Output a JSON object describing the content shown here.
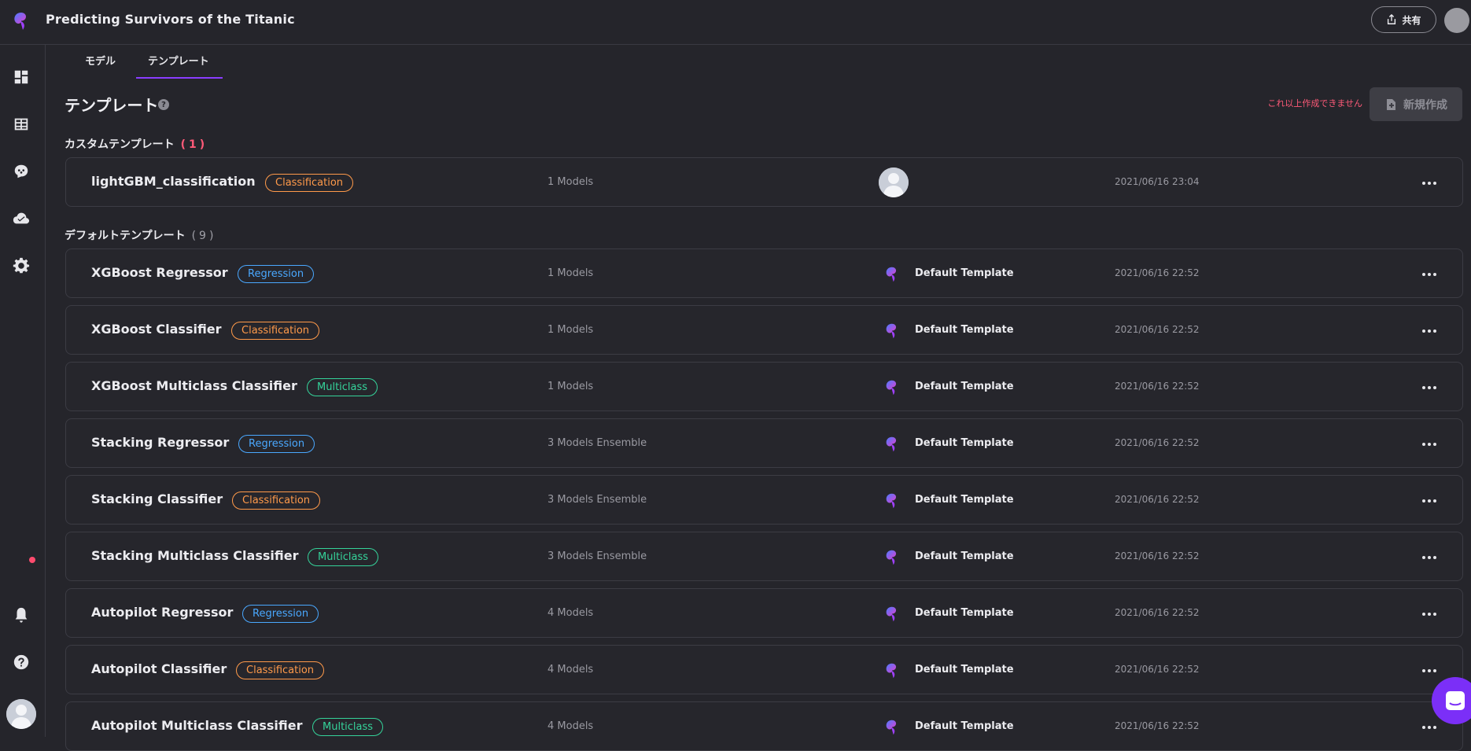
{
  "app": {
    "title": "Predicting Survivors of the Titanic",
    "share_label": "共有"
  },
  "tabs": [
    {
      "label": "モデル"
    },
    {
      "label": "テンプレート"
    }
  ],
  "header": {
    "title": "テンプレート",
    "help": "?",
    "limit_message": "これ以上作成できません",
    "new_button_label": "新規作成"
  },
  "custom_group": {
    "label": "カスタムテンプレート",
    "count": "(1)"
  },
  "default_group": {
    "label": "デフォルトテンプレート",
    "count": "(9)"
  },
  "custom_templates": [
    {
      "name": "lightGBM_classification",
      "tag": "Classification",
      "models": "1 Models",
      "owner": "",
      "date": "2021/06/16 23:04"
    }
  ],
  "default_templates": [
    {
      "name": "XGBoost Regressor",
      "tag": "Regression",
      "models": "1 Models",
      "owner": "Default Template",
      "date": "2021/06/16 22:52"
    },
    {
      "name": "XGBoost Classifier",
      "tag": "Classification",
      "models": "1 Models",
      "owner": "Default Template",
      "date": "2021/06/16 22:52"
    },
    {
      "name": "XGBoost Multiclass Classifier",
      "tag": "Multiclass",
      "models": "1 Models",
      "owner": "Default Template",
      "date": "2021/06/16 22:52"
    },
    {
      "name": "Stacking Regressor",
      "tag": "Regression",
      "models": "3 Models Ensemble",
      "owner": "Default Template",
      "date": "2021/06/16 22:52"
    },
    {
      "name": "Stacking Classifier",
      "tag": "Classification",
      "models": "3 Models Ensemble",
      "owner": "Default Template",
      "date": "2021/06/16 22:52"
    },
    {
      "name": "Stacking Multiclass Classifier",
      "tag": "Multiclass",
      "models": "3 Models Ensemble",
      "owner": "Default Template",
      "date": "2021/06/16 22:52"
    },
    {
      "name": "Autopilot Regressor",
      "tag": "Regression",
      "models": "4 Models",
      "owner": "Default Template",
      "date": "2021/06/16 22:52"
    },
    {
      "name": "Autopilot Classifier",
      "tag": "Classification",
      "models": "4 Models",
      "owner": "Default Template",
      "date": "2021/06/16 22:52"
    },
    {
      "name": "Autopilot Multiclass Classifier",
      "tag": "Multiclass",
      "models": "4 Models",
      "owner": "Default Template",
      "date": "2021/06/16 22:52"
    }
  ],
  "colors": {
    "classification": "#ff9a4a",
    "regression": "#4aa8ff",
    "multiclass": "#35d39a",
    "accent": "#8a3dff",
    "alert": "#ff5a78"
  },
  "icons": {
    "sidebar": [
      "dashboard-icon",
      "table-icon",
      "brain-icon",
      "cloud-deploy-icon",
      "gear-icon",
      "bell-icon",
      "help-circle-icon"
    ]
  }
}
